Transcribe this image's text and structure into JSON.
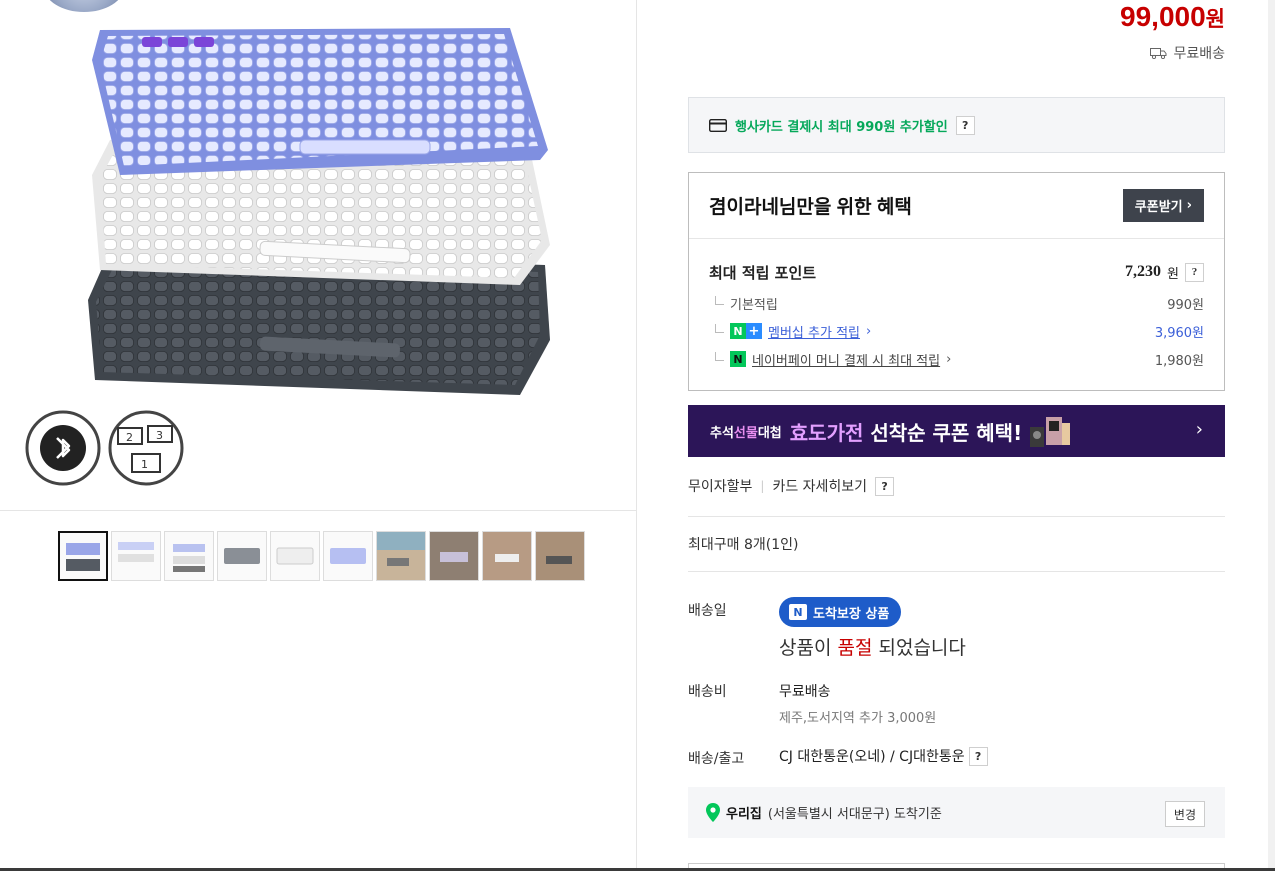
{
  "product": {
    "price_number": "99,000",
    "price_unit": "원",
    "shipping_label": "무료배송"
  },
  "card_discount": {
    "text": "행사카드 결제시 최대 990원 추가할인",
    "help": "?"
  },
  "benefit": {
    "title": "겸이라네님만을 위한 혜택",
    "coupon_button": "쿠폰받기",
    "max_points_label": "최대 적립 포인트",
    "max_points_value": "7,230",
    "max_points_unit": "원",
    "help": "?",
    "rows": [
      {
        "label": "기본적립",
        "value": "990원"
      },
      {
        "label": "멤버십 추가 적립",
        "value": "3,960원"
      },
      {
        "label": "네이버페이 머니 결제 시 최대 적립",
        "value": "1,980원"
      }
    ]
  },
  "banner": {
    "small_a": "추석",
    "small_b": "선물",
    "small_c": "대첩",
    "big_a": "효도가전",
    "big_b": " 선착순 쿠폰 혜택!"
  },
  "installment": {
    "label": "무이자할부",
    "card_detail": "카드 자세히보기",
    "help": "?"
  },
  "max_purchase": "최대구매 8개(1인)",
  "delivery": {
    "date_label": "배송일",
    "badge": "도착보장 상품",
    "soldout_a": "상품이 ",
    "soldout_b": "품절",
    "soldout_c": " 되었습니다",
    "fee_label": "배송비",
    "fee_value": "무료배송",
    "fee_extra": "제주,도서지역 추가 3,000원",
    "carrier_label": "배송/출고",
    "carrier_value": "CJ 대한통운(오네) / CJ대한통운",
    "help": "?"
  },
  "address": {
    "home": "우리집",
    "detail": "(서울특별시 서대문구) 도착기준",
    "change": "변경"
  },
  "colors": {
    "price_red": "#c70000",
    "naver_green": "#03c75a",
    "banner_bg": "#2c1558",
    "badge_blue": "#1e5cc9",
    "keyboard_lavender": "#8f9ce8",
    "keyboard_white": "#f2f2f2",
    "keyboard_graphite": "#4a5058"
  }
}
